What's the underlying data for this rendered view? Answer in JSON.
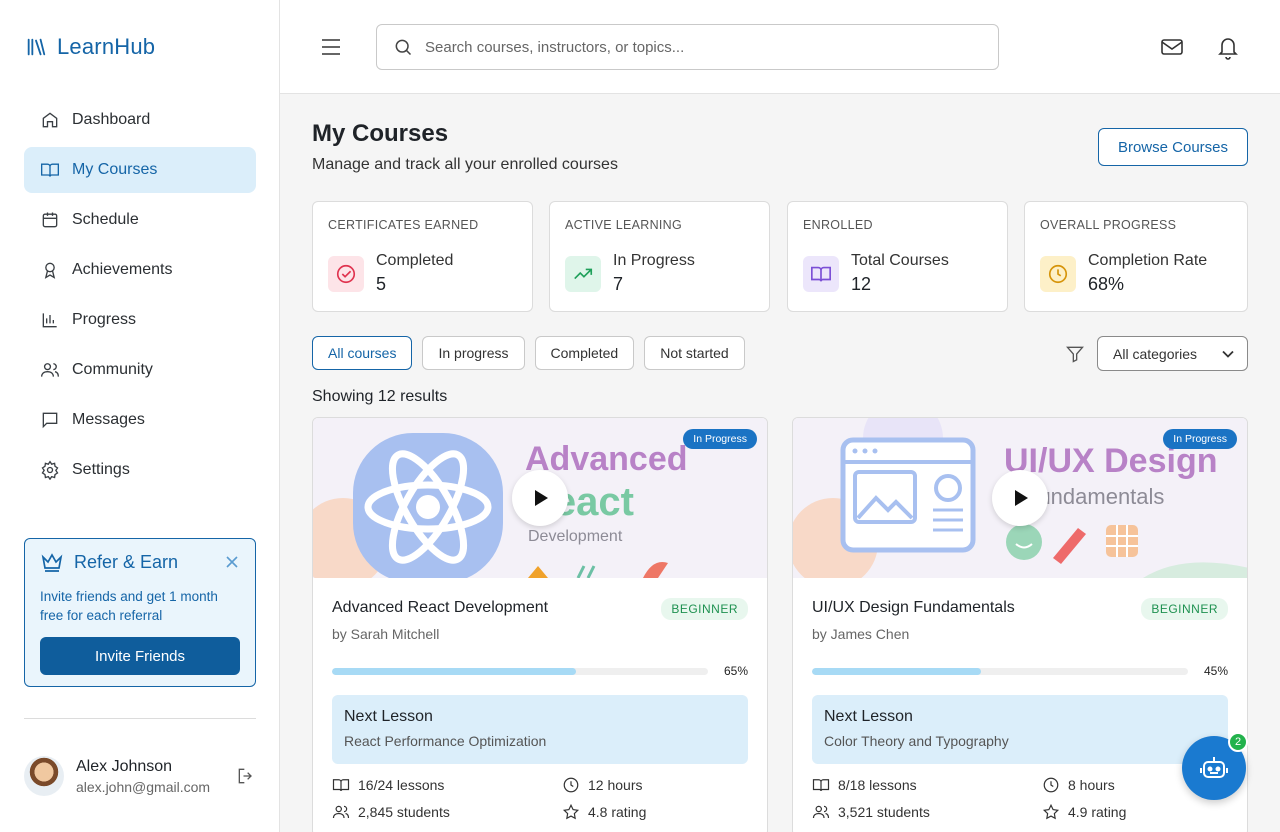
{
  "app": {
    "name": "LearnHub"
  },
  "sidebar": {
    "items": [
      {
        "label": "Dashboard",
        "icon": "home-icon"
      },
      {
        "label": "My Courses",
        "icon": "book-icon",
        "active": true
      },
      {
        "label": "Schedule",
        "icon": "calendar-icon"
      },
      {
        "label": "Achievements",
        "icon": "award-icon"
      },
      {
        "label": "Progress",
        "icon": "bar-chart-icon"
      },
      {
        "label": "Community",
        "icon": "users-icon"
      },
      {
        "label": "Messages",
        "icon": "message-icon"
      },
      {
        "label": "Settings",
        "icon": "gear-icon"
      }
    ],
    "refer": {
      "title": "Refer & Earn",
      "text": "Invite friends and get 1 month free for each referral",
      "button": "Invite Friends"
    },
    "user": {
      "name": "Alex Johnson",
      "email": "alex.john@gmail.com"
    }
  },
  "topbar": {
    "search_placeholder": "Search courses, instructors, or topics..."
  },
  "page": {
    "title": "My Courses",
    "subtitle": "Manage and track all your enrolled courses",
    "browse_button": "Browse Courses"
  },
  "stats": [
    {
      "label": "CERTIFICATES EARNED",
      "name": "Completed",
      "value": "5"
    },
    {
      "label": "ACTIVE LEARNING",
      "name": "In Progress",
      "value": "7"
    },
    {
      "label": "ENROLLED",
      "name": "Total Courses",
      "value": "12"
    },
    {
      "label": "OVERALL PROGRESS",
      "name": "Completion Rate",
      "value": "68%"
    }
  ],
  "filters": {
    "chips": [
      "All courses",
      "In progress",
      "Completed",
      "Not started"
    ],
    "category": "All categories"
  },
  "results_text": "Showing 12 results",
  "courses": [
    {
      "status": "In Progress",
      "thumb_line1": "Advanced",
      "thumb_line2": "React",
      "thumb_line3": "Development",
      "title": "Advanced React Development",
      "instructor": "by Sarah Mitchell",
      "level": "BEGINNER",
      "progress": 65,
      "progress_label": "65%",
      "next_title": "Next Lesson",
      "next_lesson": "React Performance Optimization",
      "lessons": "16/24 lessons",
      "hours": "12 hours",
      "students": "2,845 students",
      "rating": "4.8 rating"
    },
    {
      "status": "In Progress",
      "thumb_line1": "UI/UX Design",
      "thumb_line2": "Fundamentals",
      "title": "UI/UX Design Fundamentals",
      "instructor": "by James Chen",
      "level": "BEGINNER",
      "progress": 45,
      "progress_label": "45%",
      "next_title": "Next Lesson",
      "next_lesson": "Color Theory and Typography",
      "lessons": "8/18 lessons",
      "hours": "8 hours",
      "students": "3,521 students",
      "rating": "4.9 rating"
    }
  ],
  "assistant": {
    "badge": "2"
  },
  "colors": {
    "primary": "#1565a7",
    "active_bg": "#dbeefa",
    "badge_green": "#22b24c"
  }
}
